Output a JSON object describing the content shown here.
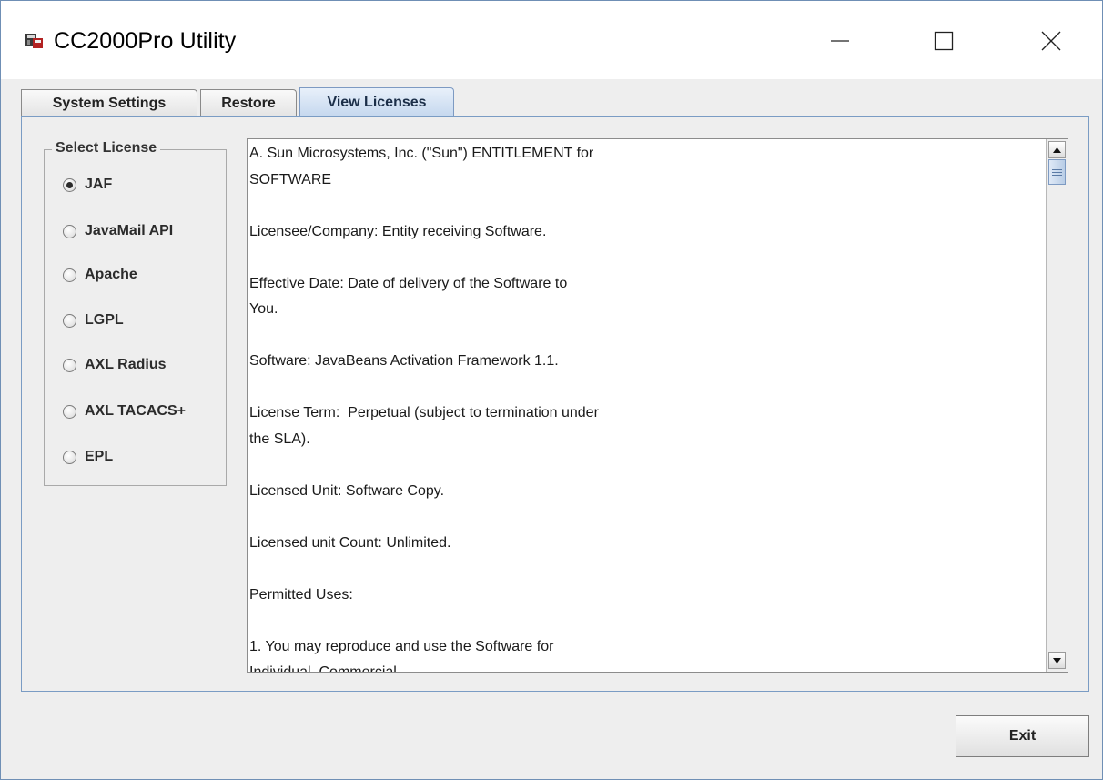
{
  "window": {
    "title": "CC2000Pro Utility",
    "controls": [
      "minimize-icon",
      "maximize-icon",
      "close-icon"
    ]
  },
  "tabs": [
    {
      "label": "System Settings",
      "selected": false
    },
    {
      "label": "Restore",
      "selected": false
    },
    {
      "label": "View Licenses",
      "selected": true
    }
  ],
  "license_group": {
    "title": "Select License",
    "options": [
      {
        "label": "JAF",
        "checked": true
      },
      {
        "label": "JavaMail API",
        "checked": false
      },
      {
        "label": "Apache",
        "checked": false
      },
      {
        "label": "LGPL",
        "checked": false
      },
      {
        "label": "AXL Radius",
        "checked": false
      },
      {
        "label": "AXL TACACS+",
        "checked": false
      },
      {
        "label": "EPL",
        "checked": false
      }
    ]
  },
  "license_text": "A. Sun Microsystems, Inc. (\"Sun\") ENTITLEMENT for\nSOFTWARE\n\nLicensee/Company: Entity receiving Software.\n\nEffective Date: Date of delivery of the Software to\nYou.\n\nSoftware: JavaBeans Activation Framework 1.1.\n\nLicense Term:  Perpetual (subject to termination under\nthe SLA).\n\nLicensed Unit: Software Copy.\n\nLicensed unit Count: Unlimited.\n\nPermitted Uses:\n\n1. You may reproduce and use the Software for\nIndividual, Commercial",
  "buttons": {
    "exit_label": "Exit"
  },
  "colors": {
    "window_border": "#6f8fb5",
    "selected_tab": "#c4d7ee",
    "background": "#eeeeee"
  }
}
